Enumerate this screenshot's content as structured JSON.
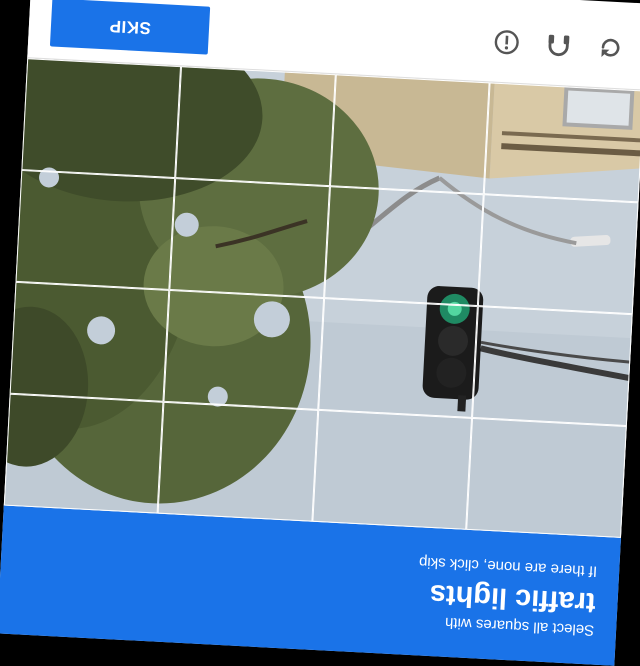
{
  "header": {
    "instruction_line1": "Select all squares with",
    "target": "traffic lights",
    "instruction_line3": "If there are none, click skip"
  },
  "grid": {
    "rows": 4,
    "cols": 4,
    "tiles": [
      {
        "row": 1,
        "col": 1
      },
      {
        "row": 1,
        "col": 2
      },
      {
        "row": 1,
        "col": 3
      },
      {
        "row": 1,
        "col": 4
      },
      {
        "row": 2,
        "col": 1
      },
      {
        "row": 2,
        "col": 2
      },
      {
        "row": 2,
        "col": 3
      },
      {
        "row": 2,
        "col": 4
      },
      {
        "row": 3,
        "col": 1
      },
      {
        "row": 3,
        "col": 2
      },
      {
        "row": 3,
        "col": 3
      },
      {
        "row": 3,
        "col": 4
      },
      {
        "row": 4,
        "col": 1
      },
      {
        "row": 4,
        "col": 2
      },
      {
        "row": 4,
        "col": 3
      },
      {
        "row": 4,
        "col": 4
      }
    ]
  },
  "footer": {
    "reload_icon": "reload-icon",
    "audio_icon": "headphones-icon",
    "info_icon": "info-icon",
    "skip_label": "SKIP"
  },
  "colors": {
    "accent": "#1a73e8",
    "sky": "#c3ced9",
    "foliage": "#4f5e34",
    "building": "#d6c7ab"
  }
}
